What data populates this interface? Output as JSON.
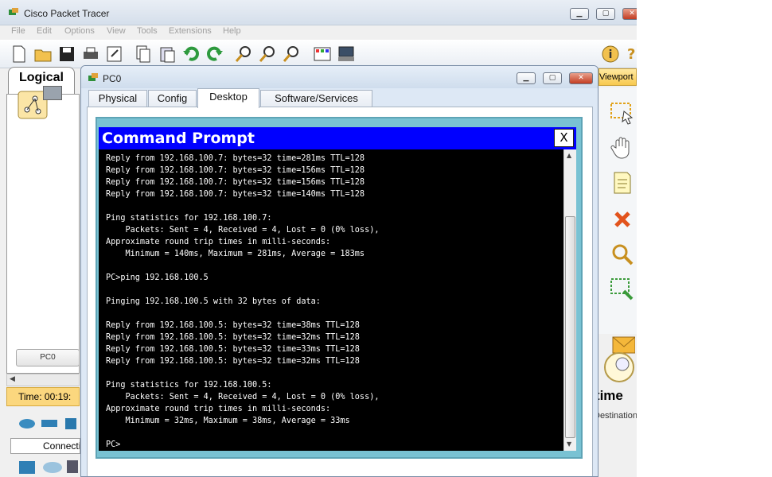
{
  "app": {
    "title": "Cisco Packet Tracer",
    "menu": [
      "File",
      "Edit",
      "Options",
      "View",
      "Tools",
      "Extensions",
      "Help"
    ],
    "help_icon_label": "?"
  },
  "workspace": {
    "logical_tab": "Logical",
    "device_label": "PC0",
    "time_label": "Time: 00:19:",
    "connections_label": "Connections",
    "viewport_label": "Viewport",
    "realtime_label": "Realtime",
    "destination_label": "Destination"
  },
  "pc_window": {
    "title": "PC0",
    "tabs": [
      "Physical",
      "Config",
      "Desktop",
      "Software/Services"
    ],
    "active_tab": "Desktop"
  },
  "command_prompt": {
    "title": "Command Prompt",
    "close_label": "X",
    "lines": [
      "Reply from 192.168.100.7: bytes=32 time=281ms TTL=128",
      "Reply from 192.168.100.7: bytes=32 time=156ms TTL=128",
      "Reply from 192.168.100.7: bytes=32 time=156ms TTL=128",
      "Reply from 192.168.100.7: bytes=32 time=140ms TTL=128",
      "",
      "Ping statistics for 192.168.100.7:",
      "    Packets: Sent = 4, Received = 4, Lost = 0 (0% loss),",
      "Approximate round trip times in milli-seconds:",
      "    Minimum = 140ms, Maximum = 281ms, Average = 183ms",
      "",
      "PC>ping 192.168.100.5",
      "",
      "Pinging 192.168.100.5 with 32 bytes of data:",
      "",
      "Reply from 192.168.100.5: bytes=32 time=38ms TTL=128",
      "Reply from 192.168.100.5: bytes=32 time=32ms TTL=128",
      "Reply from 192.168.100.5: bytes=32 time=33ms TTL=128",
      "Reply from 192.168.100.5: bytes=32 time=32ms TTL=128",
      "",
      "Ping statistics for 192.168.100.5:",
      "    Packets: Sent = 4, Received = 4, Lost = 0 (0% loss),",
      "Approximate round trip times in milli-seconds:",
      "    Minimum = 32ms, Maximum = 38ms, Average = 33ms",
      "",
      "PC>"
    ]
  },
  "colors": {
    "cmd_header": "#0000ff",
    "cmd_background": "#000000",
    "cmd_text": "#ffffff",
    "cmd_frame": "#79c2d3",
    "timebar": "#fbd77e"
  },
  "icons": {
    "toolbar": [
      "new-file-icon",
      "open-folder-icon",
      "save-icon",
      "print-icon",
      "activity-wizard-icon",
      "copy-icon",
      "paste-icon",
      "undo-icon",
      "redo-icon",
      "zoom-in-icon",
      "zoom-reset-icon",
      "zoom-out-icon",
      "palette-icon",
      "custom-device-icon",
      "info-icon",
      "help-icon"
    ],
    "right_tools": [
      "select-icon",
      "move-hand-icon",
      "note-icon",
      "delete-icon",
      "inspect-icon",
      "resize-icon",
      "add-pdu-icon"
    ]
  }
}
